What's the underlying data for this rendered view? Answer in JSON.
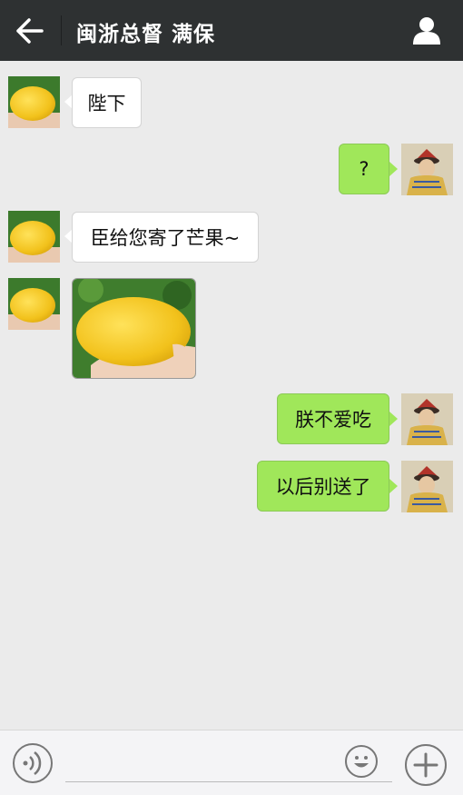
{
  "header": {
    "title": "闽浙总督 满保",
    "back_icon": "arrow-left-icon",
    "profile_icon": "person-icon",
    "bg_color": "#2e3132"
  },
  "messages": [
    {
      "side": "left",
      "type": "text",
      "text": "陛下"
    },
    {
      "side": "right",
      "type": "text",
      "text": "?"
    },
    {
      "side": "left",
      "type": "text",
      "text": "臣给您寄了芒果~"
    },
    {
      "side": "left",
      "type": "image",
      "content": "mango-photo"
    },
    {
      "side": "right",
      "type": "text",
      "text": "朕不爱吃"
    },
    {
      "side": "right",
      "type": "text",
      "text": "以后别送了"
    }
  ],
  "colors": {
    "chat_bg": "#ebebeb",
    "bubble_left": "#ffffff",
    "bubble_right": "#a0e75a"
  },
  "input_bar": {
    "voice_icon": "voice-icon",
    "emoji_icon": "emoji-icon",
    "plus_icon": "plus-icon"
  }
}
